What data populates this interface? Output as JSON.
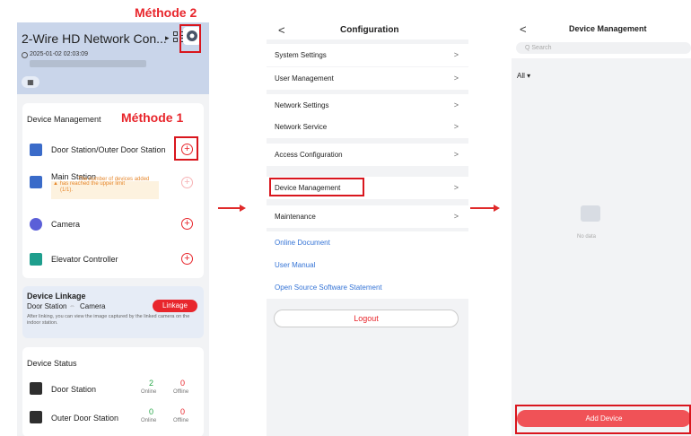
{
  "panel1": {
    "method2_label": "Méthode 2",
    "method1_label": "Méthode 1",
    "device_title": "2-Wire HD Network Con...",
    "timestamp": "2025-01-02 02:03:09",
    "device_management": {
      "title": "Device Management",
      "items": [
        {
          "label": "Door Station/Outer Door Station",
          "icon": "door-station-icon"
        },
        {
          "label": "Main Station",
          "icon": "main-station-icon"
        },
        {
          "label": "Camera",
          "icon": "camera-icon"
        },
        {
          "label": "Elevator Controller",
          "icon": "elevator-icon"
        }
      ],
      "warning_line1": "The number of devices added",
      "warning_line2": "has reached the upper limit",
      "warning_line3": "(1/1)."
    },
    "linkage": {
      "title": "Device Linkage",
      "subtitle_left": "Door Station",
      "subtitle_right": "Camera",
      "button": "Linkage",
      "desc": "After linking, you can view the image captured by the linked camera on the indoor station."
    },
    "status": {
      "title": "Device Status",
      "rows": [
        {
          "label": "Door Station",
          "online": "2",
          "offline": "0"
        },
        {
          "label": "Outer Door Station",
          "online": "0",
          "offline": "0"
        }
      ],
      "online_label": "Online",
      "offline_label": "Offline"
    }
  },
  "panel2": {
    "back": "<",
    "title": "Configuration",
    "rows": [
      "System Settings",
      "User Management",
      "Network Settings",
      "Network Service",
      "Access Configuration",
      "Device Management",
      "Maintenance"
    ],
    "chevron": ">",
    "links": [
      "Online Document",
      "User Manual",
      "Open Source Software Statement"
    ],
    "logout": "Logout"
  },
  "panel3": {
    "back": "<",
    "title": "Device Management",
    "search_placeholder": "Q  Search",
    "filter": "All ▾",
    "empty_text": "No data",
    "add_button": "Add Device"
  },
  "colors": {
    "accent_red": "#e8262c",
    "link_blue": "#3574d6",
    "online_green": "#2aa84a"
  }
}
